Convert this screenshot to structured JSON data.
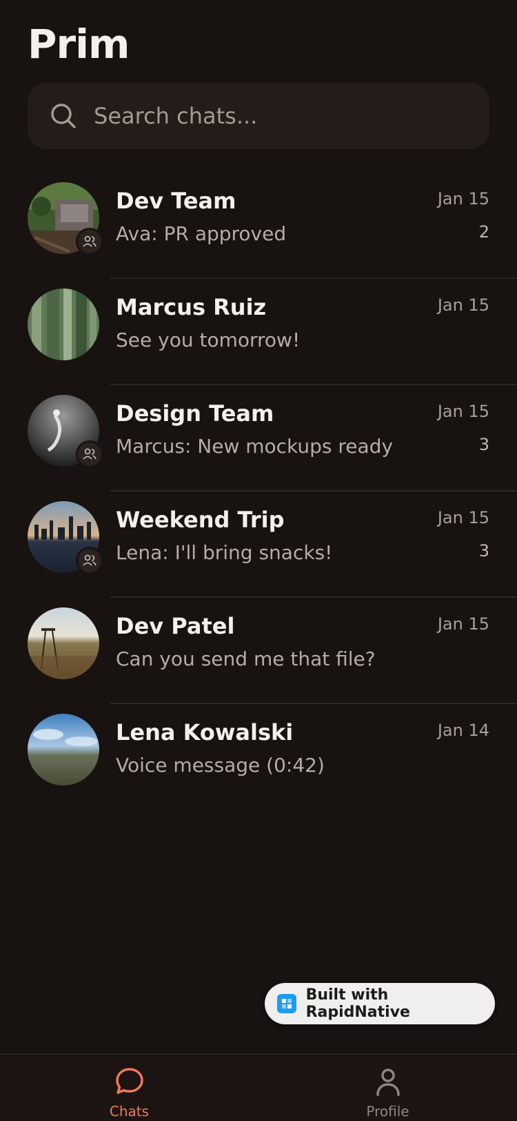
{
  "app": {
    "title": "Prim"
  },
  "search": {
    "placeholder": "Search chats..."
  },
  "chats": [
    {
      "name": "Dev Team",
      "preview": "Ava: PR approved",
      "date": "Jan 15",
      "unread": "2",
      "group": true
    },
    {
      "name": "Marcus Ruiz",
      "preview": "See you tomorrow!",
      "date": "Jan 15",
      "unread": "",
      "group": false
    },
    {
      "name": "Design Team",
      "preview": "Marcus: New mockups ready",
      "date": "Jan 15",
      "unread": "3",
      "group": true
    },
    {
      "name": "Weekend Trip",
      "preview": "Lena: I'll bring snacks!",
      "date": "Jan 15",
      "unread": "3",
      "group": true
    },
    {
      "name": "Dev Patel",
      "preview": "Can you send me that file?",
      "date": "Jan 15",
      "unread": "",
      "group": false
    },
    {
      "name": "Lena Kowalski",
      "preview": "Voice message (0:42)",
      "date": "Jan 14",
      "unread": "",
      "group": false
    }
  ],
  "badge": {
    "label": "Built with RapidNative"
  },
  "tabs": [
    {
      "label": "Chats",
      "icon": "chat-bubble-icon",
      "active": true
    },
    {
      "label": "Profile",
      "icon": "person-icon",
      "active": false
    }
  ],
  "colors": {
    "background": "#181210",
    "accent": "#f07a5c"
  }
}
